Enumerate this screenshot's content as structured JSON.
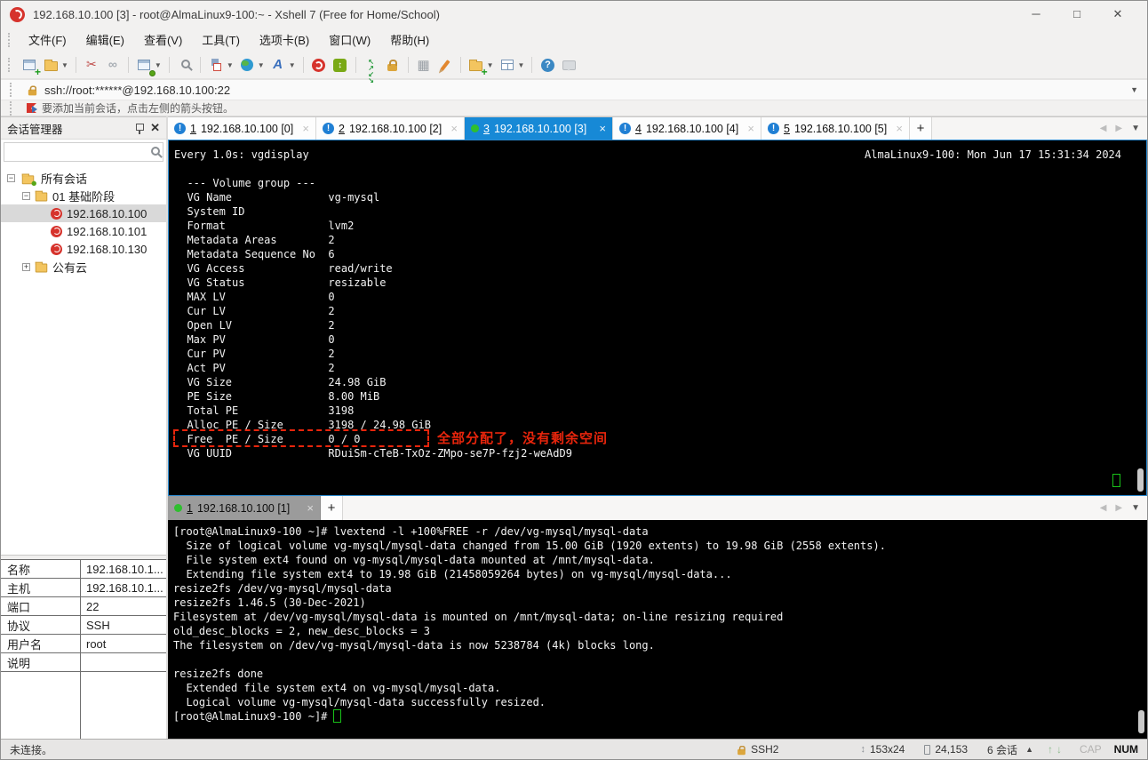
{
  "window": {
    "title": "192.168.10.100 [3] - root@AlmaLinux9-100:~ - Xshell 7 (Free for Home/School)",
    "controls": {
      "minimize": "─",
      "maximize": "□",
      "close": "✕"
    }
  },
  "menu": {
    "items": [
      "文件(F)",
      "编辑(E)",
      "查看(V)",
      "工具(T)",
      "选项卡(B)",
      "窗口(W)",
      "帮助(H)"
    ]
  },
  "toolbar": {
    "icons": [
      "new-session",
      "open-folder",
      "disconnect",
      "reconnect",
      "session-properties",
      "find",
      "compose",
      "web-browser",
      "font",
      "xshell",
      "xftp",
      "fullscreen",
      "lock-screen",
      "virtual-keyboard",
      "highlight-pen",
      "new-folder",
      "tile-windows",
      "help",
      "message"
    ]
  },
  "address_bar": {
    "value": "ssh://root:******@192.168.10.100:22"
  },
  "hint_bar": {
    "text": "要添加当前会话，点击左侧的箭头按钮。"
  },
  "session_manager": {
    "title": "会话管理器",
    "tree": {
      "root": "所有会话",
      "group1": "01 基础阶段",
      "sessions": [
        "192.168.10.100",
        "192.168.10.101",
        "192.168.10.130"
      ],
      "group2": "公有云"
    }
  },
  "properties": {
    "rows": [
      {
        "label": "名称",
        "value": "192.168.10.1..."
      },
      {
        "label": "主机",
        "value": "192.168.10.1..."
      },
      {
        "label": "端口",
        "value": "22"
      },
      {
        "label": "协议",
        "value": "SSH"
      },
      {
        "label": "用户名",
        "value": "root"
      },
      {
        "label": "说明",
        "value": ""
      }
    ]
  },
  "tabs": {
    "upper": [
      {
        "num": "1",
        "label": "192.168.10.100 [0]"
      },
      {
        "num": "2",
        "label": "192.168.10.100 [2]"
      },
      {
        "num": "3",
        "label": "192.168.10.100 [3]"
      },
      {
        "num": "4",
        "label": "192.168.10.100 [4]"
      },
      {
        "num": "5",
        "label": "192.168.10.100 [5]"
      }
    ],
    "lower": [
      {
        "num": "1",
        "label": "192.168.10.100 [1]"
      }
    ],
    "new_tab": "+",
    "close": "×"
  },
  "terminal_top": {
    "header_left": "Every 1.0s: vgdisplay",
    "header_right": "AlmaLinux9-100: Mon Jun 17 15:31:34 2024",
    "lines": [
      "",
      "  --- Volume group ---",
      "  VG Name               vg-mysql",
      "  System ID",
      "  Format                lvm2",
      "  Metadata Areas        2",
      "  Metadata Sequence No  6",
      "  VG Access             read/write",
      "  VG Status             resizable",
      "  MAX LV                0",
      "  Cur LV                2",
      "  Open LV               2",
      "  Max PV                0",
      "  Cur PV                2",
      "  Act PV                2",
      "  VG Size               24.98 GiB",
      "  PE Size               8.00 MiB",
      "  Total PE              3198",
      "  Alloc PE / Size       3198 / 24.98 GiB",
      "  Free  PE / Size       0 / 0",
      "  VG UUID               RDuiSm-cTeB-TxOz-ZMpo-se7P-fzj2-weAdD9"
    ],
    "annotation": "全部分配了，没有剩余空间",
    "highlight_color": "#e8250c"
  },
  "terminal_bottom": {
    "lines": [
      "[root@AlmaLinux9-100 ~]# lvextend -l +100%FREE -r /dev/vg-mysql/mysql-data",
      "  Size of logical volume vg-mysql/mysql-data changed from 15.00 GiB (1920 extents) to 19.98 GiB (2558 extents).",
      "  File system ext4 found on vg-mysql/mysql-data mounted at /mnt/mysql-data.",
      "  Extending file system ext4 to 19.98 GiB (21458059264 bytes) on vg-mysql/mysql-data...",
      "resize2fs /dev/vg-mysql/mysql-data",
      "resize2fs 1.46.5 (30-Dec-2021)",
      "Filesystem at /dev/vg-mysql/mysql-data is mounted on /mnt/mysql-data; on-line resizing required",
      "old_desc_blocks = 2, new_desc_blocks = 3",
      "The filesystem on /dev/vg-mysql/mysql-data is now 5238784 (4k) blocks long.",
      "",
      "resize2fs done",
      "  Extended file system ext4 on vg-mysql/mysql-data.",
      "  Logical volume vg-mysql/mysql-data successfully resized.",
      "[root@AlmaLinux9-100 ~]# "
    ]
  },
  "status_bar": {
    "left": "未连接。",
    "protocol": "SSH2",
    "terminal_size": "153x24",
    "cursor_position": "24,153",
    "sessions": "6 会话",
    "cap": "CAP",
    "num": "NUM"
  }
}
